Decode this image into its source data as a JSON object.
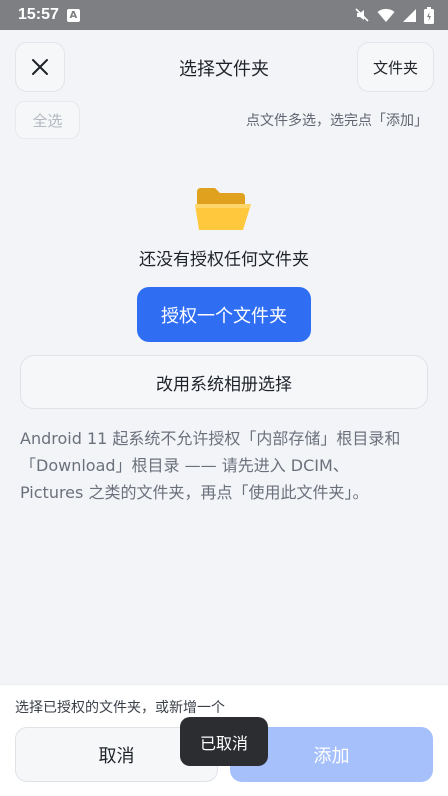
{
  "status_bar": {
    "time": "15:57",
    "notification_icon": "a-letter-icon",
    "icons": [
      "mute-icon",
      "wifi-icon",
      "signal-icon",
      "battery-icon"
    ]
  },
  "header": {
    "close_icon": "close-icon",
    "title": "选择文件夹",
    "folder_button_label": "文件夹"
  },
  "toolbar": {
    "select_all_label": "全选",
    "hint": "点文件多选，选完点「添加」"
  },
  "empty_state": {
    "icon": "open-folder-icon",
    "message": "还没有授权任何文件夹",
    "grant_button_label": "授权一个文件夹",
    "system_picker_label": "改用系统相册选择",
    "note_lines": [
      "Android 11 起系统不允许授权「内部存储」根目录和",
      "「Download」根目录 —— 请先进入 DCIM、",
      "Pictures 之类的文件夹，再点「使用此文件夹」。"
    ]
  },
  "bottom_bar": {
    "hint": "选择已授权的文件夹，或新增一个",
    "cancel_label": "取消",
    "add_label": "添加"
  },
  "toast": {
    "text": "已取消"
  },
  "colors": {
    "primary": "#2f6ef3",
    "primary_disabled": "#a5c0fb",
    "background": "#f3f4f7",
    "status_bar": "#7d7f82",
    "toast_bg": "#2b2d31"
  }
}
